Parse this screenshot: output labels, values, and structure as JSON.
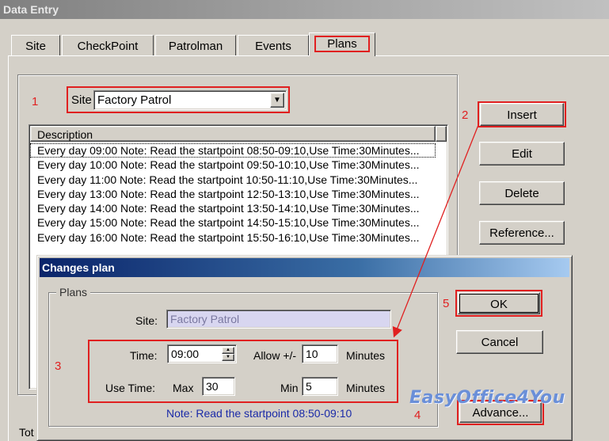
{
  "window": {
    "title": "Data Entry"
  },
  "tabs": [
    {
      "label": "Site"
    },
    {
      "label": "CheckPoint"
    },
    {
      "label": "Patrolman"
    },
    {
      "label": "Events"
    },
    {
      "label": "Plans"
    }
  ],
  "active_tab": "Plans",
  "site_selector": {
    "label": "Site",
    "value": "Factory Patrol"
  },
  "plans_list": {
    "header": "Description",
    "rows": [
      "Every day 09:00 Note: Read the startpoint 08:50-09:10,Use Time:30Minutes...",
      "Every day 10:00 Note: Read the startpoint 09:50-10:10,Use Time:30Minutes...",
      "Every day 11:00 Note: Read the startpoint 10:50-11:10,Use Time:30Minutes...",
      "Every day 13:00 Note: Read the startpoint 12:50-13:10,Use Time:30Minutes...",
      "Every day 14:00 Note: Read the startpoint 13:50-14:10,Use Time:30Minutes...",
      "Every day 15:00 Note: Read the startpoint 14:50-15:10,Use Time:30Minutes...",
      "Every day 16:00 Note: Read the startpoint 15:50-16:10,Use Time:30Minutes..."
    ]
  },
  "side_buttons": {
    "insert": "Insert",
    "edit": "Edit",
    "delete": "Delete",
    "reference": "Reference..."
  },
  "footer_partial": "Tot",
  "annotations": {
    "n1": "1",
    "n2": "2",
    "n3": "3",
    "n4": "4",
    "n5": "5",
    "color": "#e02020"
  },
  "dialog": {
    "title": "Changes plan",
    "group_label": "Plans",
    "site_label": "Site:",
    "site_value": "Factory Patrol",
    "time_label": "Time:",
    "time_value": "09:00",
    "allow_label": "Allow +/-",
    "allow_value": "10",
    "allow_unit": "Minutes",
    "use_time_label": "Use Time:",
    "max_label": "Max",
    "max_value": "30",
    "min_label": "Min",
    "min_value": "5",
    "min_unit": "Minutes",
    "note": "Note: Read the startpoint 08:50-09:10",
    "ok": "OK",
    "cancel": "Cancel",
    "advance": "Advance..."
  },
  "watermark": "EasyOffice4You"
}
